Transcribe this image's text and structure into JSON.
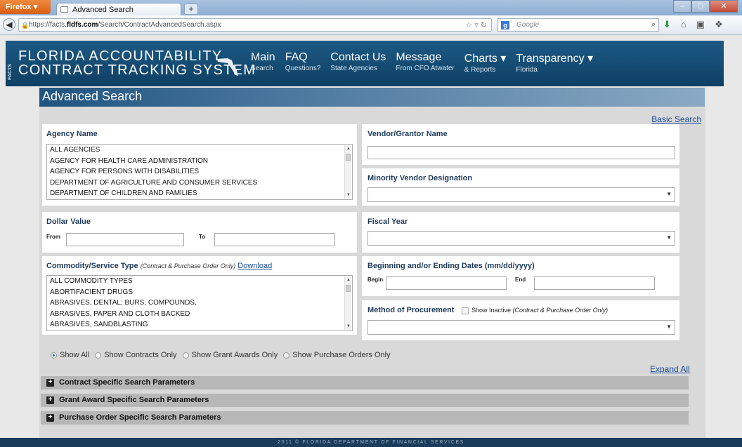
{
  "browser": {
    "app_button": "Firefox",
    "tab_title": "Advanced Search",
    "new_tab": "+",
    "url_prefix": "https://facts.",
    "url_host": "fldfs.com",
    "url_path": "/Search/ContractAdvancedSearch.aspx",
    "search_placeholder": "Google"
  },
  "header": {
    "logo_line1": "FLORIDA ACCOUNTABILITY",
    "logo_line2": "CONTRACT TRACKING SYSTEM",
    "logo_side": "FACTS",
    "nav": [
      {
        "title": "Main",
        "sub": "Search"
      },
      {
        "title": "FAQ",
        "sub": "Questions?"
      },
      {
        "title": "Contact Us",
        "sub": "State Agencies"
      },
      {
        "title": "Message",
        "sub": "From CFO Atwater"
      },
      {
        "title": "Charts ▾",
        "sub": "& Reports"
      },
      {
        "title": "Transparency ▾",
        "sub": "Florida"
      }
    ]
  },
  "search": {
    "title": "Advanced Search",
    "basic_link": "Basic Search",
    "agency": {
      "label": "Agency Name",
      "options": [
        "ALL AGENCIES",
        "AGENCY FOR HEALTH CARE ADMINISTRATION",
        "AGENCY FOR PERSONS WITH DISABILITIES",
        "DEPARTMENT OF AGRICULTURE AND CONSUMER SERVICES",
        "DEPARTMENT OF CHILDREN AND FAMILIES"
      ]
    },
    "vendor": {
      "label": "Vendor/Grantor Name",
      "value": ""
    },
    "minority": {
      "label": "Minority Vendor Designation",
      "value": ""
    },
    "dollar": {
      "label": "Dollar Value",
      "from_label": "From",
      "to_label": "To",
      "from": "",
      "to": ""
    },
    "fiscal": {
      "label": "Fiscal Year",
      "value": ""
    },
    "commodity": {
      "label": "Commodity/Service Type",
      "note": "(Contract & Purchase Order Only)",
      "download": "Download",
      "options": [
        "ALL COMMODITY TYPES",
        "ABORTIFACIENT DRUGS",
        "ABRASIVES, DENTAL; BURS, COMPOUNDS,",
        "ABRASIVES, PAPER AND CLOTH BACKED",
        "ABRASIVES, SANDBLASTING"
      ]
    },
    "dates": {
      "label": "Beginning and/or Ending Dates (mm/dd/yyyy)",
      "begin_label": "Begin",
      "end_label": "End",
      "begin": "",
      "end": ""
    },
    "procurement": {
      "label": "Method of Procurement",
      "show_inactive": "Show Inactive",
      "note": "(Contract & Purchase Order Only)",
      "value": ""
    },
    "radios": [
      "Show All",
      "Show Contracts Only",
      "Show Grant Awards Only",
      "Show Purchase Orders Only"
    ],
    "selected_radio": "Show All",
    "expand_link": "Expand All",
    "sections": [
      "Contract Specific Search Parameters",
      "Grant Award Specific Search Parameters",
      "Purchase Order Specific Search Parameters"
    ]
  },
  "footer": "2011 © FLORIDA DEPARTMENT OF FINANCIAL SERVICES"
}
